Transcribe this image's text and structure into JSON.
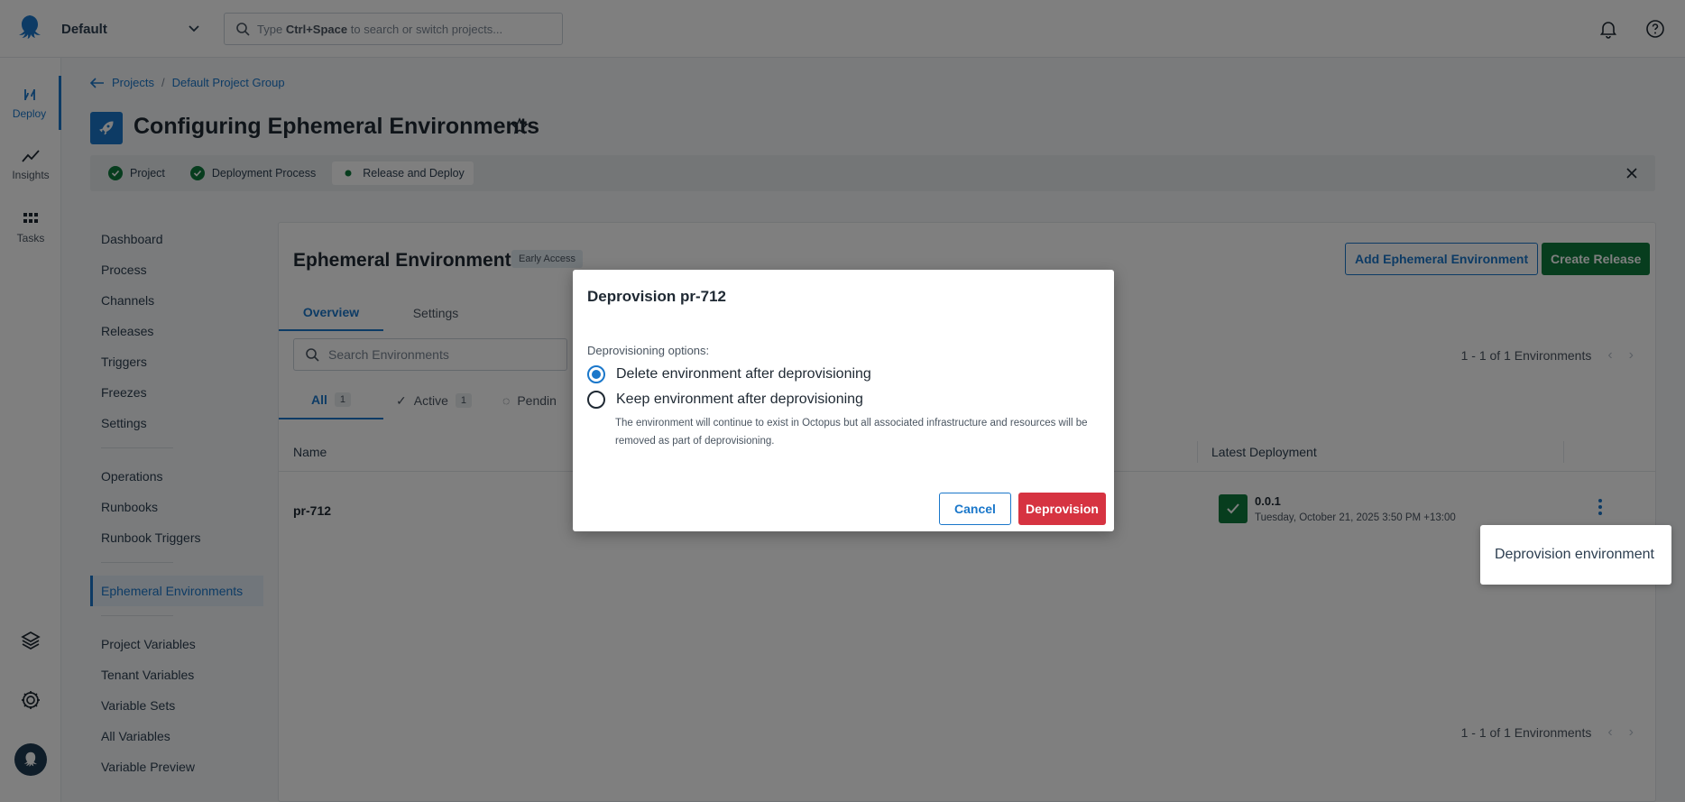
{
  "topbar": {
    "space": "Default",
    "search_prefix": "Type",
    "search_shortcut": "Ctrl+Space",
    "search_suffix": "to search or switch projects..."
  },
  "rail": {
    "items": [
      {
        "label": "Deploy",
        "icon": "deploy-icon"
      },
      {
        "label": "Insights",
        "icon": "insights-icon"
      },
      {
        "label": "Tasks",
        "icon": "tasks-icon"
      }
    ]
  },
  "breadcrumb": {
    "projects": "Projects",
    "sep": "/",
    "group": "Default Project Group"
  },
  "page": {
    "title": "Configuring Ephemeral Environments"
  },
  "stepper": {
    "steps": [
      "Project",
      "Deployment Process",
      "Release and Deploy"
    ]
  },
  "sidenav": {
    "group1": [
      "Dashboard",
      "Process",
      "Channels",
      "Releases",
      "Triggers",
      "Freezes",
      "Settings"
    ],
    "group2": [
      "Operations",
      "Runbooks",
      "Runbook Triggers"
    ],
    "active": "Ephemeral Environments",
    "group3": [
      "Project Variables",
      "Tenant Variables",
      "Variable Sets",
      "All Variables",
      "Variable Preview"
    ]
  },
  "panel": {
    "title": "Ephemeral Environments",
    "badge": "Early Access",
    "add_button": "Add Ephemeral Environment",
    "create_button": "Create Release",
    "tabs": [
      "Overview",
      "Settings"
    ],
    "search_placeholder": "Search Environments",
    "pager_text": "1 - 1 of 1 Environments",
    "filters": [
      {
        "label": "All",
        "count": "1"
      },
      {
        "label": "Active",
        "count": "1"
      },
      {
        "label": "Pendin"
      }
    ],
    "columns": {
      "name": "Name",
      "latest": "Latest Deployment"
    },
    "rows": [
      {
        "name": "pr-712",
        "version": "0.0.1",
        "date": "Tuesday, October 21, 2025 3:50 PM +13:00"
      }
    ]
  },
  "context_menu": {
    "item": "Deprovision environment"
  },
  "dialog": {
    "title": "Deprovision pr-712",
    "label": "Deprovisioning options:",
    "option_delete": "Delete environment after deprovisioning",
    "option_keep": "Keep environment after deprovisioning",
    "help": "The environment will continue to exist in Octopus but all associated infrastructure and resources will be removed as part of deprovisioning.",
    "cancel": "Cancel",
    "confirm": "Deprovision",
    "selected": "delete"
  },
  "colors": {
    "accent": "#1a77ca",
    "success": "#0f7b3d",
    "danger": "#d63341"
  }
}
